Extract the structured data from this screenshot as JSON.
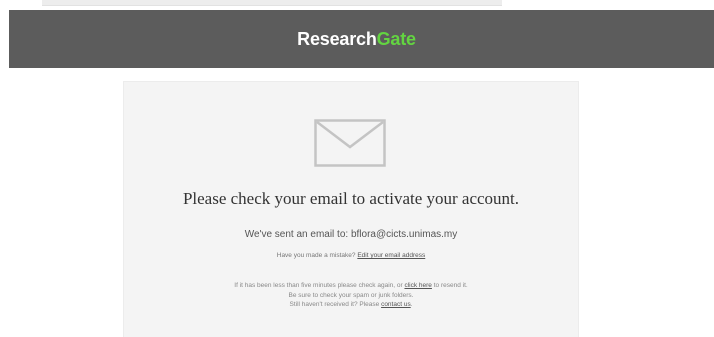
{
  "header": {
    "logo_part1": "Research",
    "logo_part2": "Gate"
  },
  "main": {
    "title": "Please check your email to activate your account.",
    "sent_prefix": "We've sent an email to: ",
    "email": "bflora@cicts.unimas.my",
    "mistake_prefix": "Have you made a mistake? ",
    "edit_link": "Edit your email address",
    "resend_prefix": "If it has been less than five minutes please check again, or ",
    "resend_link": "click here",
    "resend_suffix": " to resend it.",
    "spam_note": "Be sure to check your spam or junk folders.",
    "contact_prefix": "Still haven't received it? Please ",
    "contact_link": "contact us",
    "contact_suffix": "."
  },
  "icons": {
    "envelope": "envelope-icon"
  },
  "colors": {
    "header_bg": "#5c5c5c",
    "brand_green": "#63d441",
    "card_bg": "#f4f4f4"
  }
}
